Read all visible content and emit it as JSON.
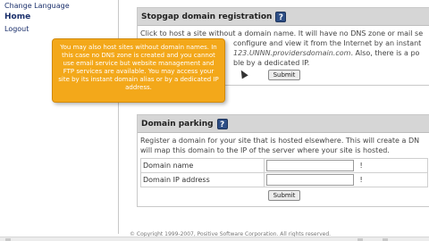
{
  "sidebar": {
    "items": [
      {
        "label": "Change Language",
        "bold": false
      },
      {
        "label": "Home",
        "bold": true
      },
      {
        "label": "Logout",
        "bold": false
      }
    ]
  },
  "stopgap": {
    "title": "Stopgap domain registration",
    "line1": "Click to host a site without a domain name. It will have no DNS zone or mail se",
    "line2_a": "configure and view it from the Internet by an instant",
    "line3_url": "123.UNNN.providersdomain.com",
    "line3_b": ". Also, there is a po",
    "line4": "ble by a dedicated IP.",
    "submit_label": "Submit"
  },
  "parking": {
    "title": "Domain parking",
    "text": "Register a domain for your site that is hosted elsewhere. This will create a DN will map this domain to the IP of the server where your site is hosted.",
    "fields": [
      {
        "label": "Domain name",
        "value": "",
        "required_mark": "!"
      },
      {
        "label": "Domain IP address",
        "value": "",
        "required_mark": "!"
      }
    ],
    "submit_label": "Submit"
  },
  "tooltip": {
    "text": "You may also host sites without domain names. In this case no DNS zone is created and you cannot use email service but website management and FTP services are available. You may access your site by its instant domain alias or by a dedicated IP address."
  },
  "footer": {
    "copyright": "© Copyright 1999-2007, Positive Software Corporation. All rights reserved."
  },
  "colors": {
    "tooltip_bg": "#f3a81a",
    "panel_header": "#d6d6d6",
    "help_icon": "#2e4f86",
    "link": "#1a2f6b"
  },
  "icons": [
    "help-icon",
    "cursor-arrow-icon"
  ]
}
